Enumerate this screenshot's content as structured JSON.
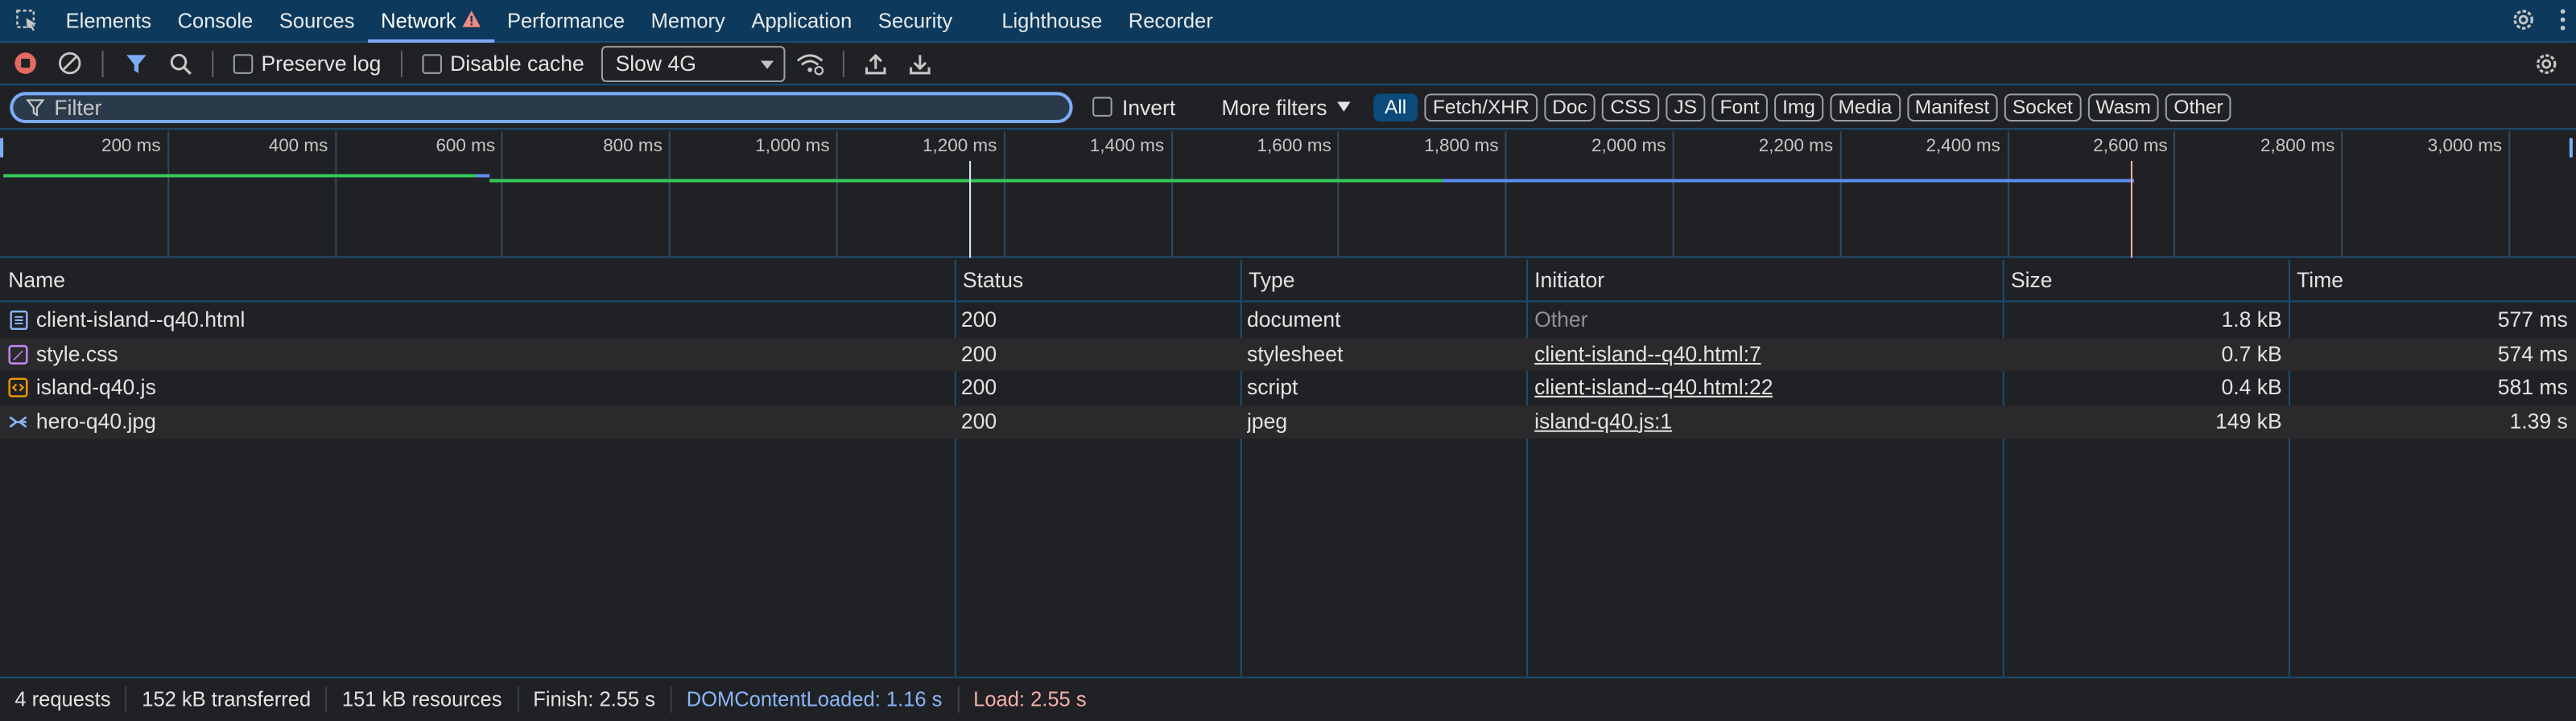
{
  "main_tabs": [
    {
      "label": "Elements"
    },
    {
      "label": "Console"
    },
    {
      "label": "Sources"
    },
    {
      "label": "Network",
      "active": true,
      "warning": true
    },
    {
      "label": "Performance"
    },
    {
      "label": "Memory"
    },
    {
      "label": "Application"
    },
    {
      "label": "Security"
    },
    {
      "label": "Lighthouse"
    },
    {
      "label": "Recorder"
    }
  ],
  "toolbar": {
    "preserve_log_label": "Preserve log",
    "disable_cache_label": "Disable cache",
    "throttling_value": "Slow 4G"
  },
  "filter": {
    "placeholder": "Filter",
    "invert_label": "Invert",
    "more_filters_label": "More filters",
    "chips": [
      "All",
      "Fetch/XHR",
      "Doc",
      "CSS",
      "JS",
      "Font",
      "Img",
      "Media",
      "Manifest",
      "Socket",
      "Wasm",
      "Other"
    ],
    "active_chip": "All"
  },
  "overview": {
    "ticks": [
      "200 ms",
      "400 ms",
      "600 ms",
      "800 ms",
      "1,000 ms",
      "1,200 ms",
      "1,400 ms",
      "1,600 ms",
      "1,800 ms",
      "2,000 ms",
      "2,200 ms",
      "2,400 ms",
      "2,600 ms",
      "2,800 ms",
      "3,000 ms"
    ],
    "dom_content_loaded_ms": 1160,
    "load_ms": 2550
  },
  "table": {
    "columns": [
      "Name",
      "Status",
      "Type",
      "Initiator",
      "Size",
      "Time"
    ],
    "rows": [
      {
        "name": "client-island--q40.html",
        "icon": "document-icon",
        "status": "200",
        "type": "document",
        "initiator": "Other",
        "size": "1.8 kB",
        "time": "577 ms"
      },
      {
        "name": "style.css",
        "icon": "stylesheet-icon",
        "status": "200",
        "type": "stylesheet",
        "initiator": "client-island--q40.html:7",
        "size": "0.7 kB",
        "time": "574 ms"
      },
      {
        "name": "island-q40.js",
        "icon": "script-icon",
        "status": "200",
        "type": "script",
        "initiator": "client-island--q40.html:22",
        "size": "0.4 kB",
        "time": "581 ms"
      },
      {
        "name": "hero-q40.jpg",
        "icon": "image-icon",
        "status": "200",
        "type": "jpeg",
        "initiator": "island-q40.js:1",
        "size": "149 kB",
        "time": "1.39 s"
      }
    ]
  },
  "status_bar": {
    "requests": "4 requests",
    "transferred": "152 kB transferred",
    "resources": "151 kB resources",
    "finish": "Finish: 2.55 s",
    "dom_content_loaded": "DOMContentLoaded: 1.16 s",
    "load": "Load: 2.55 s"
  },
  "colors": {
    "accent": "#7cacf8",
    "dcl_line": "#8ab4f8",
    "load_line": "#f6aea9",
    "bar_green": "#34c759",
    "bar_blue": "#5b8def"
  }
}
